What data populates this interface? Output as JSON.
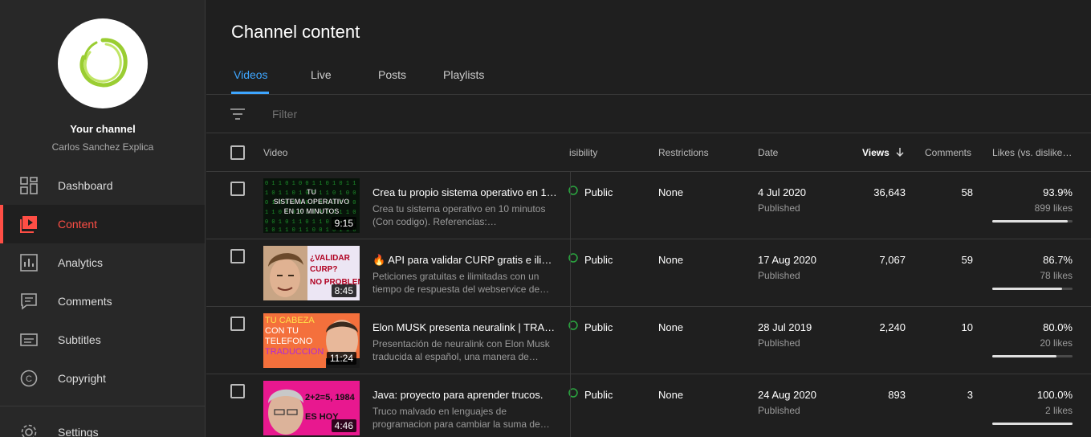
{
  "sidebar": {
    "channel_title": "Your channel",
    "channel_name": "Carlos Sanchez Explica",
    "items": [
      {
        "label": "Dashboard",
        "icon": "dashboard-icon"
      },
      {
        "label": "Content",
        "icon": "content-icon",
        "active": true
      },
      {
        "label": "Analytics",
        "icon": "analytics-icon"
      },
      {
        "label": "Comments",
        "icon": "comments-icon"
      },
      {
        "label": "Subtitles",
        "icon": "subtitles-icon"
      },
      {
        "label": "Copyright",
        "icon": "copyright-icon"
      }
    ],
    "settings_label": "Settings"
  },
  "main": {
    "title": "Channel content",
    "tabs": [
      "Videos",
      "Live",
      "Posts",
      "Playlists"
    ],
    "filter_placeholder": "Filter",
    "columns": {
      "video": "Video",
      "visibility": "isibility",
      "restrictions": "Restrictions",
      "date": "Date",
      "views": "Views",
      "comments": "Comments",
      "likes": "Likes (vs. dislike…"
    }
  },
  "videos": [
    {
      "title": "Crea tu propio sistema operativo en 1…",
      "description": "Crea tu sistema operativo en 10 minutos (Con codigo). Referencias:…",
      "duration": "9:15",
      "thumb_text": "TU\nSISTEMA OPERATIVO\nEN 10 MINUTOS",
      "visibility": "Public",
      "restrictions": "None",
      "date": "4 Jul 2020",
      "status": "Published",
      "views": "36,643",
      "comments": "58",
      "likes_pct": "93.9%",
      "likes_count": "899 likes",
      "likes_ratio": 0.939
    },
    {
      "title": "🔥 API para validar CURP gratis e ilimit…",
      "description": "Peticiones gratuitas e ilimitadas con un tiempo de respuesta del webservice de…",
      "duration": "8:45",
      "thumb_text": "¿VALIDAR\nCURP?\nNO PROBLEM",
      "visibility": "Public",
      "restrictions": "None",
      "date": "17 Aug 2020",
      "status": "Published",
      "views": "7,067",
      "comments": "59",
      "likes_pct": "86.7%",
      "likes_count": "78 likes",
      "likes_ratio": 0.867
    },
    {
      "title": "Elon MUSK presenta neuralink | TRAD…",
      "description": "Presentación de neuralink con Elon Musk traducida al español, una manera de…",
      "duration": "11:24",
      "thumb_text": "TU CABEZA\nCON TU\nTELEFONO\nTRADUCCION",
      "visibility": "Public",
      "restrictions": "None",
      "date": "28 Jul 2019",
      "status": "Published",
      "views": "2,240",
      "comments": "10",
      "likes_pct": "80.0%",
      "likes_count": "20 likes",
      "likes_ratio": 0.8
    },
    {
      "title": "Java: proyecto para aprender trucos.",
      "description": "Truco malvado en lenguajes de programacion para cambiar la suma de…",
      "duration": "4:46",
      "thumb_text": "2+2=5, 1984\nES HOY",
      "visibility": "Public",
      "restrictions": "None",
      "date": "24 Aug 2020",
      "status": "Published",
      "views": "893",
      "comments": "3",
      "likes_pct": "100.0%",
      "likes_count": "2 likes",
      "likes_ratio": 1.0
    }
  ],
  "colors": {
    "accent_red": "#ff4e45",
    "accent_blue": "#3ea6ff",
    "logo_green": "#9acd32",
    "visibility_green": "#2ba640"
  }
}
